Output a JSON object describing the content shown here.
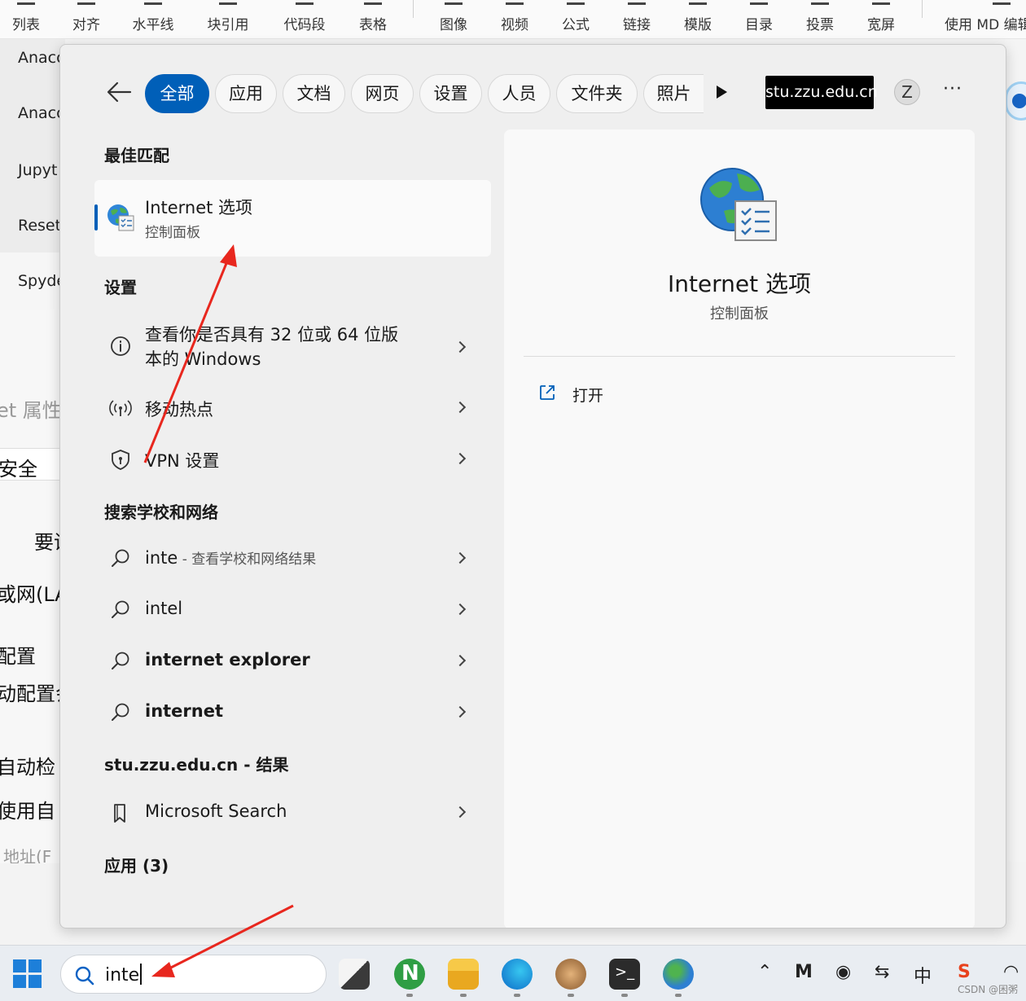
{
  "toolbar": {
    "items": [
      {
        "label": "列表",
        "icon": "list-icon"
      },
      {
        "label": "对齐",
        "icon": "align-icon"
      },
      {
        "label": "水平线",
        "icon": "horizontal-line-icon"
      },
      {
        "label": "块引用",
        "icon": "quote-icon"
      },
      {
        "label": "代码段",
        "icon": "code-icon"
      },
      {
        "label": "表格",
        "icon": "table-icon"
      },
      {
        "label": "图像",
        "icon": "image-icon"
      },
      {
        "label": "视频",
        "icon": "video-icon"
      },
      {
        "label": "公式",
        "icon": "formula-icon"
      },
      {
        "label": "链接",
        "icon": "link-icon"
      },
      {
        "label": "模版",
        "icon": "template-icon"
      },
      {
        "label": "目录",
        "icon": "toc-icon"
      },
      {
        "label": "投票",
        "icon": "vote-icon"
      },
      {
        "label": "宽屏",
        "icon": "widescreen-icon"
      }
    ],
    "md_label": "使用 MD 编辑"
  },
  "background": {
    "left_list": [
      "Anacc",
      "Anacc",
      "Jupyt",
      "Reset",
      "Spyde"
    ],
    "dialog_texts": [
      "et 属性",
      "安全",
      "要谁",
      "或网(LA",
      "配置",
      "动配置会",
      "自动检",
      "使用自",
      "地址(F"
    ]
  },
  "search": {
    "query": "inte",
    "filters": [
      "全部",
      "应用",
      "文档",
      "网页",
      "设置",
      "人员",
      "文件夹",
      "照片"
    ],
    "active_filter": "全部",
    "org": "stu.zzu.edu.cn",
    "avatar_letter": "Z",
    "more": "···",
    "best_match_header": "最佳匹配",
    "best_match": {
      "title": "Internet 选项",
      "subtitle": "控制面板"
    },
    "settings_header": "设置",
    "settings": [
      {
        "line1": "查看你是否具有 32 位或 64 位版",
        "line2": "本的 Windows",
        "icon": "info-icon"
      },
      {
        "line1": "移动热点",
        "icon": "hotspot-icon"
      },
      {
        "line1": "VPN 设置",
        "icon": "shield-icon"
      }
    ],
    "school_header": "搜索学校和网络",
    "school_results": [
      {
        "text": "inte",
        "suffix": " - 查看学校和网络结果"
      },
      {
        "text": "intel"
      },
      {
        "text": "internet explorer"
      },
      {
        "text": "internet"
      }
    ],
    "org_header": "stu.zzu.edu.cn - 结果",
    "org_results": [
      {
        "text": "Microsoft Search",
        "icon": "bookmark-icon"
      }
    ],
    "apps_header": "应用 (3)",
    "detail": {
      "title": "Internet 选项",
      "subtitle": "控制面板",
      "action": "打开"
    }
  },
  "tray": {
    "ime": "中",
    "watermark": "CSDN @困粥"
  },
  "colors": {
    "accent": "#005fb8",
    "annotation_red": "#e8271e"
  }
}
